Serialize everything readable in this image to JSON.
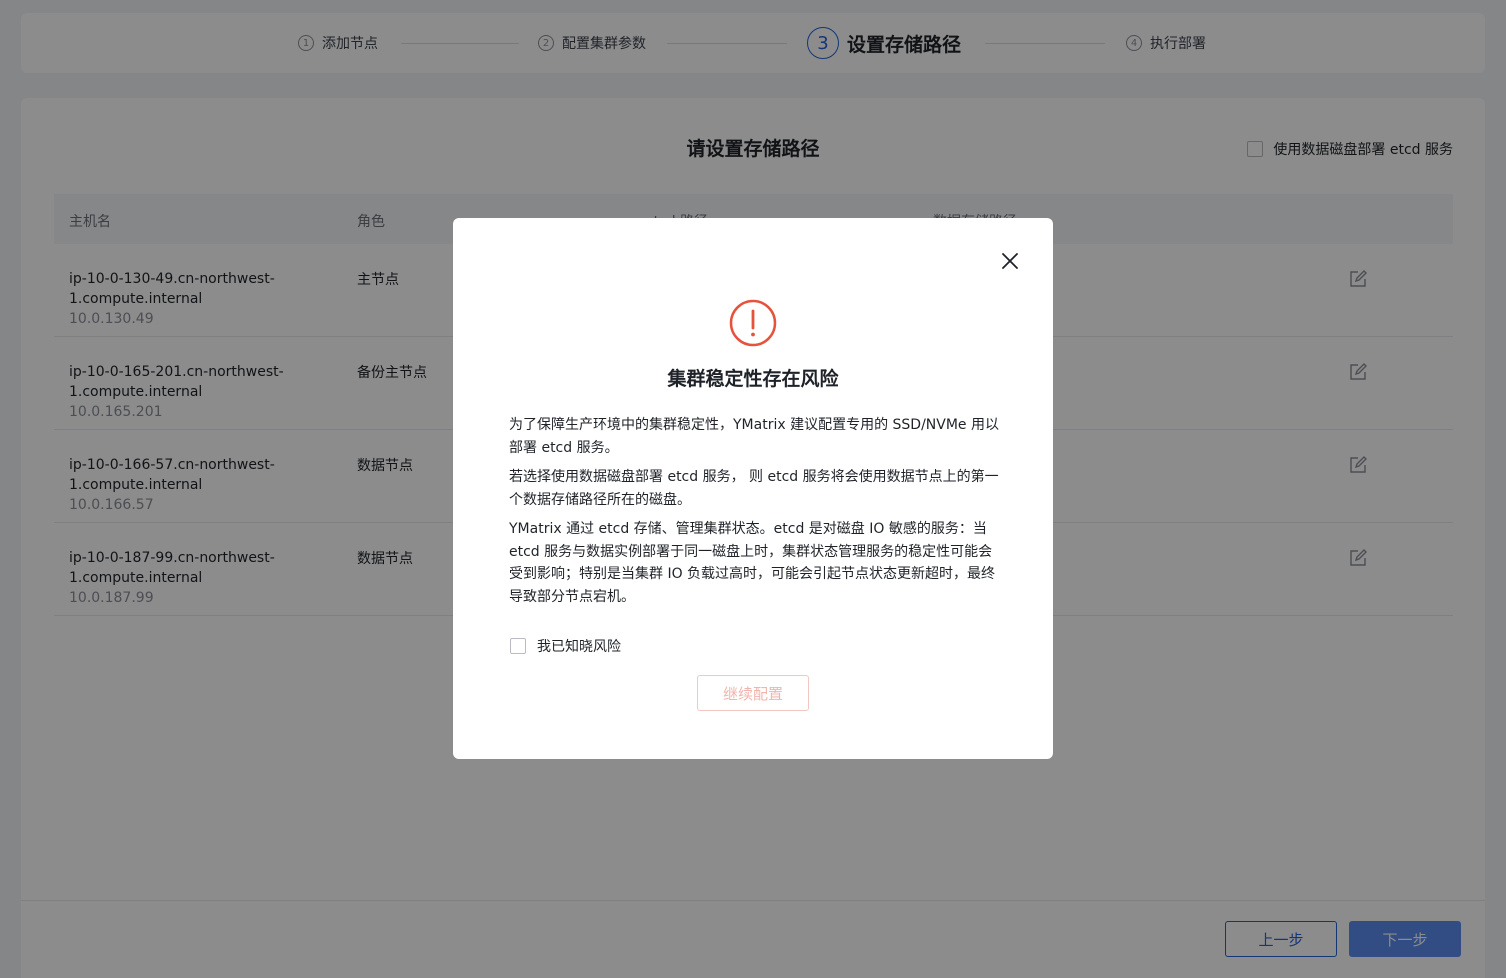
{
  "stepper": {
    "steps": [
      {
        "num": "1",
        "label": "添加节点"
      },
      {
        "num": "2",
        "label": "配置集群参数"
      },
      {
        "num": "3",
        "label": "设置存储路径"
      },
      {
        "num": "4",
        "label": "执行部署"
      }
    ],
    "active_step": 3
  },
  "card": {
    "title": "请设置存储路径",
    "etcd_option_label": "使用数据磁盘部署 etcd 服务",
    "table": {
      "headers": {
        "host": "主机名",
        "role": "角色",
        "etcd": "etcd 路径",
        "data": "数据存储路径"
      },
      "rows": [
        {
          "host": "ip-10-0-130-49.cn-northwest-1.compute.internal",
          "ip": "10.0.130.49",
          "role": "主节点"
        },
        {
          "host": "ip-10-0-165-201.cn-northwest-1.compute.internal",
          "ip": "10.0.165.201",
          "role": "备份主节点"
        },
        {
          "host": "ip-10-0-166-57.cn-northwest-1.compute.internal",
          "ip": "10.0.166.57",
          "role": "数据节点"
        },
        {
          "host": "ip-10-0-187-99.cn-northwest-1.compute.internal",
          "ip": "10.0.187.99",
          "role": "数据节点"
        }
      ]
    },
    "footer": {
      "prev_label": "上一步",
      "next_label": "下一步"
    }
  },
  "modal": {
    "title": "集群稳定性存在风险",
    "paragraphs": [
      "为了保障生产环境中的集群稳定性，YMatrix 建议配置专用的 SSD/NVMe 用以部署 etcd 服务。",
      "若选择使用数据磁盘部署 etcd 服务， 则 etcd 服务将会使用数据节点上的第一个数据存储路径所在的磁盘。",
      "YMatrix 通过 etcd 存储、管理集群状态。etcd 是对磁盘 IO 敏感的服务：当 etcd 服务与数据实例部署于同一磁盘上时，集群状态管理服务的稳定性可能会受到影响；特别是当集群 IO 负载过高时，可能会引起节点状态更新超时，最终导致部分节点宕机。"
    ],
    "ack_label": "我已知晓风险",
    "continue_label": "继续配置"
  },
  "colors": {
    "primary": "#2563d9",
    "warning": "#e5533d"
  }
}
